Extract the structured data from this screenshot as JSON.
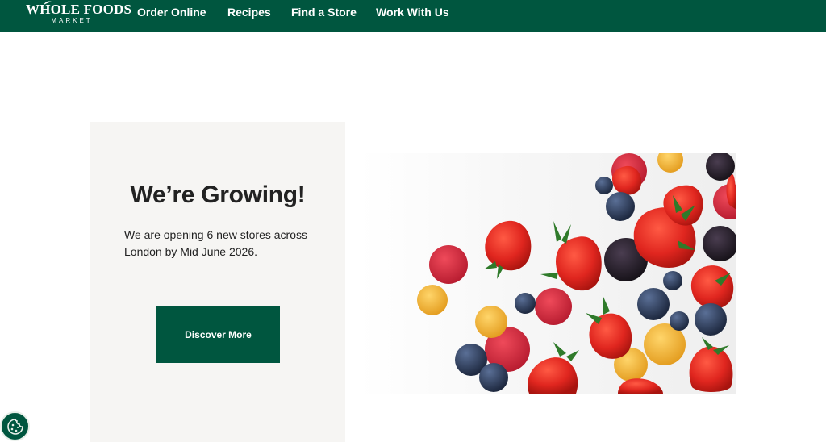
{
  "header": {
    "logo_text": "WHOLE FOODS",
    "logo_subtext": "MARKET",
    "nav": [
      {
        "label": "Order Online"
      },
      {
        "label": "Recipes"
      },
      {
        "label": "Find a Store"
      },
      {
        "label": "Work With Us"
      }
    ]
  },
  "hero": {
    "title": "We’re Growing!",
    "description": "We are opening 6 new stores across London by Mid June 2026.",
    "cta_label": "Discover More",
    "image_icon": "berries-photo"
  },
  "cookie": {
    "icon": "cookie-icon"
  },
  "colors": {
    "brand_green": "#00563f",
    "card_bg": "#f6f5f3",
    "text": "#222222",
    "strawberry": "#d62a23",
    "raspberry": "#c8213a",
    "golden_raspberry": "#f0b43c",
    "blueberry": "#2c3a55",
    "blackberry": "#1f1a22",
    "leaf": "#2f7a2a"
  }
}
